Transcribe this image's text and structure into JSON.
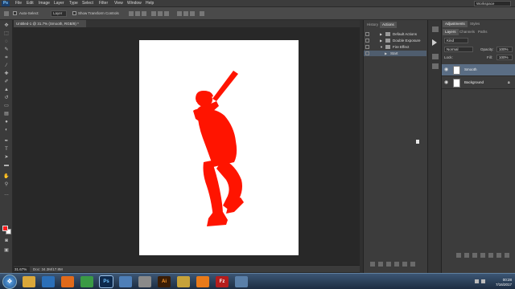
{
  "app": {
    "logo": "Ps",
    "menu": [
      "File",
      "Edit",
      "Image",
      "Layer",
      "Type",
      "Select",
      "Filter",
      "View",
      "Window",
      "Help"
    ],
    "workspace": "Workspace"
  },
  "options_bar": {
    "auto_select_label": "Auto-Select:",
    "auto_select_value": "Layer",
    "transform_label": "Show Transform Controls"
  },
  "document": {
    "tab_title": "Untitled-1 @ 31.7% (Smooth, RGB/8) *",
    "zoom": "31.67%",
    "doc_size": "Doc: 34.3M/17.8M",
    "canvas_color": "#ffffff",
    "silhouette_color": "#ff1400"
  },
  "actions_panel": {
    "tabs": [
      "History",
      "Actions"
    ],
    "rows": [
      {
        "label": "Default Actions"
      },
      {
        "label": "Double Exposure"
      },
      {
        "label": "Fire Effect"
      },
      {
        "label": "Start"
      }
    ]
  },
  "layers_panel": {
    "top_tabs": [
      "Adjustments",
      "Styles"
    ],
    "tabs": [
      "Layers",
      "Channels",
      "Paths"
    ],
    "kind_label": "Kind",
    "blend_mode": "Normal",
    "opacity_label": "Opacity:",
    "opacity": "100%",
    "lock_label": "Lock:",
    "fill_label": "Fill:",
    "fill": "100%",
    "layers": [
      {
        "name": "Smooth",
        "selected": true
      },
      {
        "name": "Background",
        "selected": false
      }
    ]
  },
  "taskbar": {
    "apps": [
      {
        "icon": "folder-icon",
        "label": ""
      },
      {
        "icon": "media-player-icon",
        "label": ""
      },
      {
        "icon": "firefox-icon",
        "label": ""
      },
      {
        "icon": "chrome-icon",
        "label": ""
      },
      {
        "icon": "photoshop-icon",
        "label": "Ps"
      },
      {
        "icon": "paint-icon",
        "label": ""
      },
      {
        "icon": "tool-icon",
        "label": ""
      },
      {
        "icon": "illustrator-icon",
        "label": "Ai"
      },
      {
        "icon": "sketch-icon",
        "label": ""
      },
      {
        "icon": "vlc-icon",
        "label": ""
      },
      {
        "icon": "filezilla-icon",
        "label": "Fz"
      },
      {
        "icon": "network-icon",
        "label": ""
      }
    ],
    "time": "00:28",
    "date": "7/16/2017"
  },
  "colors": {
    "foreground": "#ff1a1a",
    "background": "#ffffff"
  }
}
